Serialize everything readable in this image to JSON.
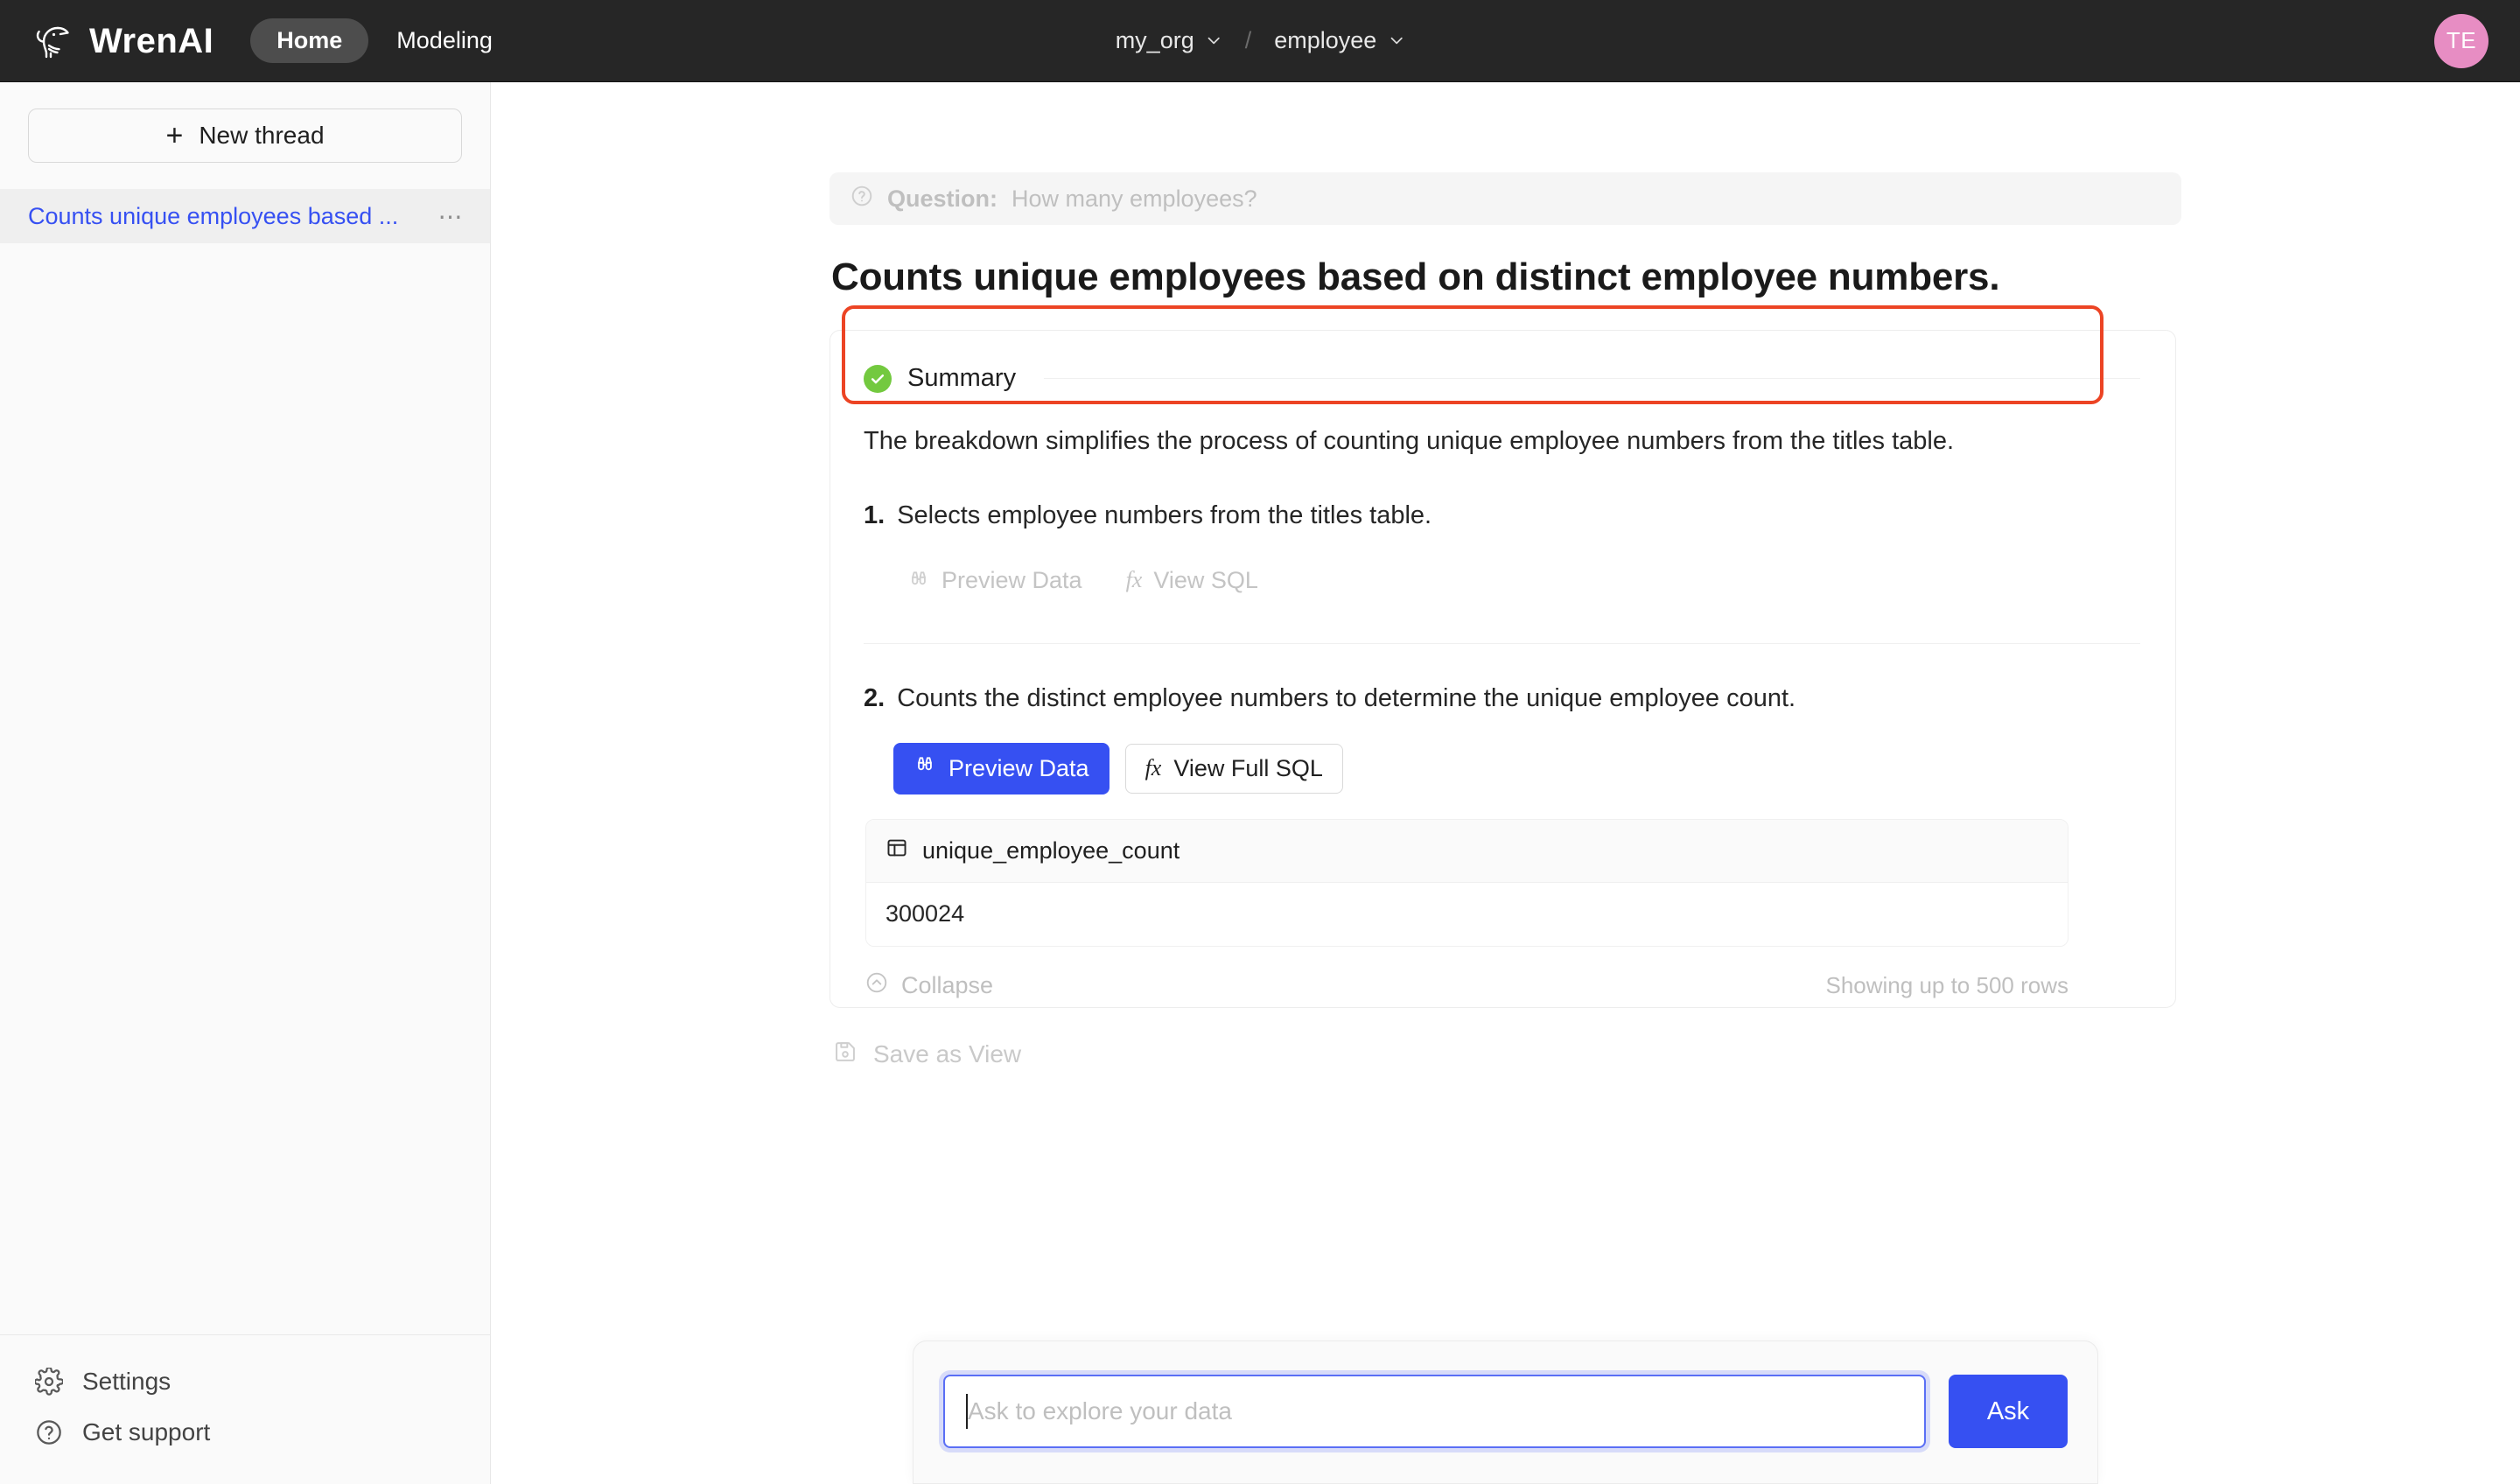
{
  "app": {
    "brand_name": "WrenAI",
    "logo_icon": "wren-bird-logo-icon"
  },
  "topbar": {
    "nav": [
      {
        "label": "Home",
        "active": true
      },
      {
        "label": "Modeling",
        "active": false
      }
    ],
    "breadcrumb": {
      "project": "my_org",
      "separator": "/",
      "dataset": "employee",
      "chevron_icon": "chevron-down-icon"
    },
    "avatar": {
      "initials": "TE",
      "color": "#e78dc3"
    }
  },
  "sidebar": {
    "new_thread_label": "New thread",
    "new_thread_icon": "plus-icon",
    "threads": [
      {
        "label": "Counts unique employees based ...",
        "selected": true,
        "more_icon": "more-vertical-icon"
      }
    ],
    "footer": [
      {
        "label": "Settings",
        "icon": "gear-icon"
      },
      {
        "label": "Get support",
        "icon": "question-circle-icon"
      }
    ]
  },
  "main": {
    "question": {
      "icon": "question-circle-icon",
      "label": "Question:",
      "text": "How many employees?"
    },
    "answer_title": "Counts unique employees based on distinct employee numbers.",
    "summary": {
      "status_icon": "check-circle-icon",
      "status_color": "#73c93f",
      "title": "Summary",
      "text": "The breakdown simplifies the process of counting unique employee numbers from the titles table.",
      "highlight_color": "#ec4424"
    },
    "steps": [
      {
        "number": "1.",
        "description": "Selects employee numbers from the titles table.",
        "actions": [
          {
            "label": "Preview Data",
            "icon": "binoculars-icon",
            "style": "disabled"
          },
          {
            "label": "View SQL",
            "icon": "fx-icon",
            "style": "disabled"
          }
        ]
      },
      {
        "number": "2.",
        "description": "Counts the distinct employee numbers to determine the unique employee count.",
        "actions": [
          {
            "label": "Preview Data",
            "icon": "binoculars-icon",
            "style": "primary"
          },
          {
            "label": "View Full SQL",
            "icon": "fx-icon",
            "style": "secondary"
          }
        ]
      }
    ],
    "result_table": {
      "column_icon": "table-column-icon",
      "columns": [
        "unique_employee_count"
      ],
      "rows": [
        [
          "300024"
        ]
      ],
      "collapse_label": "Collapse",
      "collapse_icon": "chevron-up-circle-icon",
      "rows_note": "Showing up to 500 rows"
    },
    "save_as_view": {
      "label": "Save as View",
      "icon": "save-disk-icon"
    }
  },
  "askbar": {
    "input_value": "",
    "placeholder": "Ask to explore your data",
    "submit_label": "Ask",
    "accent_color": "#3650f2"
  }
}
